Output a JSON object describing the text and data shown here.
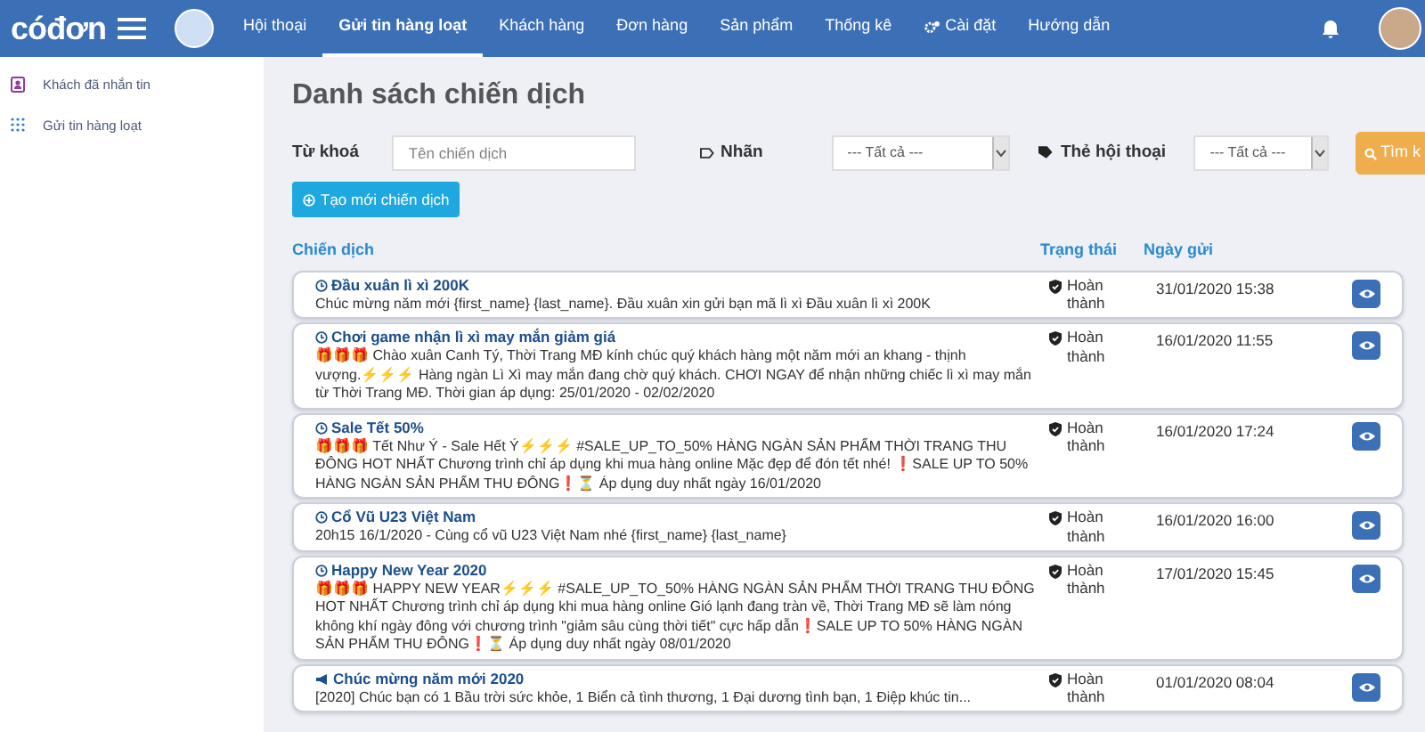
{
  "logo": "cóđơn",
  "nav": [
    {
      "label": "Hội thoại",
      "selected": false
    },
    {
      "label": "Gửi tin hàng loạt",
      "selected": true
    },
    {
      "label": "Khách hàng",
      "selected": false
    },
    {
      "label": "Đơn hàng",
      "selected": false
    },
    {
      "label": "Sản phẩm",
      "selected": false
    },
    {
      "label": "Thống kê",
      "selected": false
    },
    {
      "label": "Cài đặt",
      "selected": false,
      "kind": "gear"
    },
    {
      "label": "Hướng dẫn",
      "selected": false
    }
  ],
  "sidebar": {
    "items": [
      {
        "label": "Khách đã nhắn tin",
        "kind": "contact"
      },
      {
        "label": "Gửi tin hàng loạt",
        "kind": "grid"
      }
    ]
  },
  "page_title": "Danh sách chiến dịch",
  "filters": {
    "keyword_label": "Từ khoá",
    "keyword_placeholder": "Tên chiến dịch",
    "tag_label": "Nhãn",
    "tag_value": "--- Tất cả ---",
    "conv_label": "Thẻ hội thoại",
    "conv_value": "--- Tất cả ---",
    "search_button": "Tìm k",
    "create_button": "Tạo mới chiến dịch"
  },
  "table": {
    "columns": [
      "Chiến dịch",
      "Trạng thái",
      "Ngày gửi"
    ],
    "rows": [
      {
        "kind": "scheduled",
        "title": "Đầu xuân lì xì 200K",
        "body": "Chúc mừng năm mới {first_name} {last_name}. Đầu xuân xin gửi bạn mã lì xì Đầu xuân lì xì 200K",
        "status": "Hoàn thành",
        "date": "31/01/2020 15:38"
      },
      {
        "kind": "scheduled",
        "title": "Chơi game nhận lì xì may mắn giảm giá",
        "body": "🎁🎁🎁 Chào xuân Canh Tý, Thời Trang MĐ kính chúc quý khách hàng một năm mới an khang - thịnh vượng.⚡⚡⚡ Hàng ngàn Lì Xì may mắn đang chờ quý khách. CHƠI NGAY để nhận những chiếc lì xì may mắn từ Thời Trang MĐ. Thời gian áp dụng: 25/01/2020 - 02/02/2020",
        "status": "Hoàn thành",
        "date": "16/01/2020 11:55"
      },
      {
        "kind": "scheduled",
        "title": "Sale Tết 50%",
        "body": "🎁🎁🎁 Tết Như Ý - Sale Hết Ý⚡⚡⚡ #SALE_UP_TO_50% HÀNG NGÀN SẢN PHẨM THỜI TRANG THU ĐÔNG HOT NHẤT Chương trình chỉ áp dụng khi mua hàng online Mặc đẹp để đón tết nhé! ❗SALE UP TO 50% HÀNG NGÀN SẢN PHẨM THU ĐÔNG❗⏳ Áp dụng duy nhất ngày 16/01/2020",
        "status": "Hoàn thành",
        "date": "16/01/2020 17:24"
      },
      {
        "kind": "scheduled",
        "title": "Cổ Vũ U23 Việt Nam",
        "body": "20h15 16/1/2020 - Cùng cổ vũ U23 Việt Nam nhé {first_name} {last_name}",
        "status": "Hoàn thành",
        "date": "16/01/2020 16:00"
      },
      {
        "kind": "scheduled",
        "title": "Happy New Year 2020",
        "body": "🎁🎁🎁 HAPPY NEW YEAR⚡⚡⚡ #SALE_UP_TO_50% HÀNG NGÀN SẢN PHẨM THỜI TRANG THU ĐÔNG HOT NHẤT Chương trình chỉ áp dụng khi mua hàng online Gió lạnh đang tràn về, Thời Trang MĐ sẽ làm nóng không khí ngày đông với chương trình \"giảm sâu cùng thời tiết\" cực hấp dẫn❗SALE UP TO 50% HÀNG NGÀN SẢN PHẨM THU ĐÔNG❗⏳ Áp dụng duy nhất ngày 08/01/2020",
        "status": "Hoàn thành",
        "date": "17/01/2020 15:45"
      },
      {
        "kind": "announcement",
        "title": "Chúc mừng năm mới 2020",
        "body": "[2020] Chúc bạn có 1 Bầu trời sức khỏe, 1 Biển cả tình thương, 1 Đại dương tình bạn, 1 Điệp khúc tin...",
        "status": "Hoàn thành",
        "date": "01/01/2020 08:04"
      }
    ]
  }
}
